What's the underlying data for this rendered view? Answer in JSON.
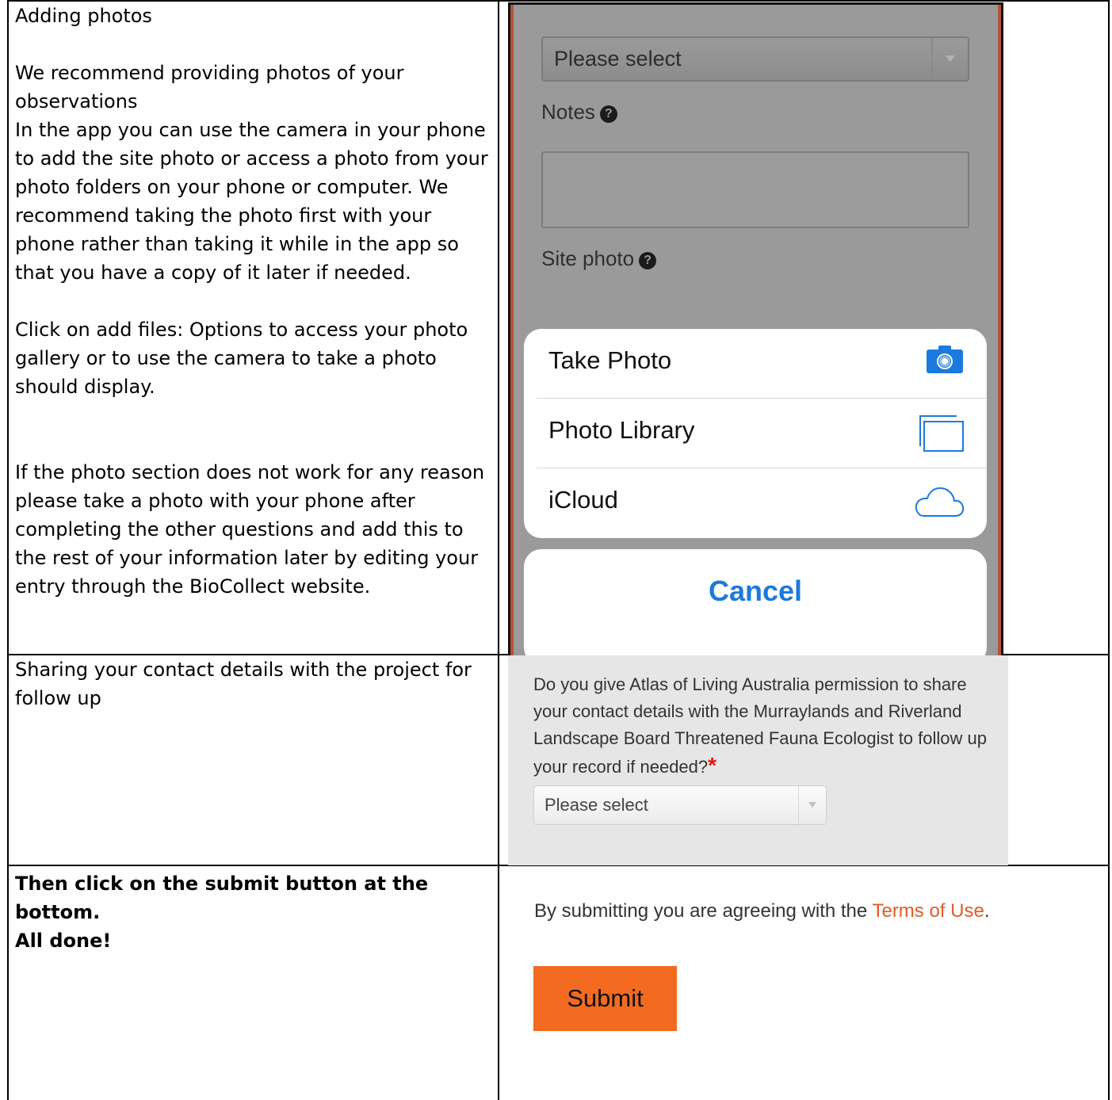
{
  "rows": [
    {
      "title": "Adding photos",
      "paragraphs": [
        "We recommend providing photos of your observations",
        "In the app you can use the camera in your phone to add the site photo or access a photo from your photo folders on your phone or computer.  We recommend taking the photo first with your phone rather than taking it while in the app so that you have a copy of it later if needed.",
        "Click on add files: Options to access your photo gallery or to use the camera to take a photo should display.",
        "If the photo section does not work for any reason please take a photo with your phone after completing the other questions and add this to the rest of your information later by editing your entry through the BioCollect website."
      ]
    },
    {
      "title": "Sharing your contact details with the project for follow up"
    },
    {
      "line1": "Then click on the submit button at the bottom.",
      "line2": "All done!"
    }
  ],
  "phone_form": {
    "select_placeholder": "Please select",
    "notes_label": "Notes",
    "site_photo_label": "Site photo",
    "help_glyph": "?",
    "action_sheet": [
      {
        "label": "Take Photo",
        "icon": "camera-icon"
      },
      {
        "label": "Photo Library",
        "icon": "photo-library-icon"
      },
      {
        "label": "iCloud",
        "icon": "icloud-icon"
      }
    ],
    "cancel_label": "Cancel"
  },
  "consent_form": {
    "question": "Do you give Atlas of Living Australia permission to share your contact details with the Murraylands and Riverland Landscape Board Threatened Fauna Ecologist to follow up your record if needed?",
    "required_mark": "*",
    "select_placeholder": "Please select"
  },
  "submit_form": {
    "agree_text": "By submitting you are agreeing with the",
    "terms_link": "Terms of Use",
    "period": ".",
    "submit_label": "Submit"
  },
  "colors": {
    "accent_orange": "#f26b21",
    "link_orange": "#e05c26",
    "ios_blue": "#1a7ae0",
    "required_red": "#e41b1b"
  }
}
